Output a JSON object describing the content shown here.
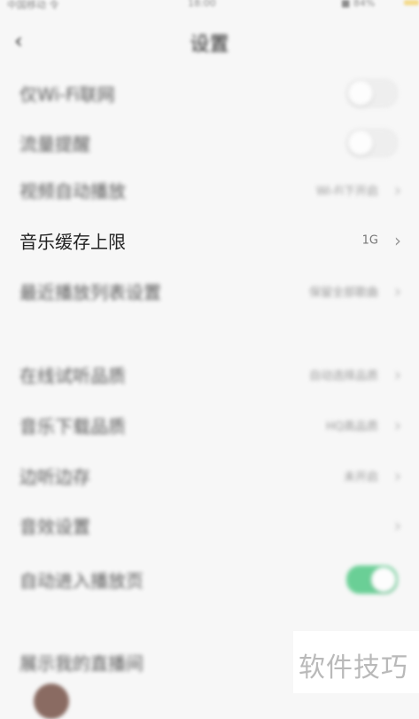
{
  "status_bar": {
    "carrier": "中国移动 令",
    "time": "18:00",
    "battery": "■ 84%",
    "battery_color": "#f1c232"
  },
  "nav": {
    "back_icon": "chevron-left-icon",
    "title": "设置"
  },
  "settings": [
    {
      "label": "仅Wi-Fi联网",
      "control": "toggle",
      "on": false
    },
    {
      "label": "流量提醒",
      "control": "toggle",
      "on": false
    },
    {
      "label": "视频自动播放",
      "value": "Wi-Fi下开启",
      "control": "chevron"
    },
    {
      "label": "音乐缓存上限",
      "value": "1G",
      "control": "chevron"
    },
    {
      "label": "最近播放列表设置",
      "value": "保留全部歌曲",
      "control": "chevron"
    },
    {
      "label": "在线试听品质",
      "value": "自动选择品质",
      "control": "chevron"
    },
    {
      "label": "音乐下载品质",
      "value": "HQ高品质",
      "control": "chevron"
    },
    {
      "label": "边听边存",
      "value": "未开启",
      "control": "chevron"
    },
    {
      "label": "音效设置",
      "value": "",
      "control": "chevron"
    },
    {
      "label": "自动进入播放页",
      "control": "toggle",
      "on": true
    },
    {
      "label": "展示我的直播间",
      "control": "none"
    }
  ],
  "colors": {
    "toggle_on": "#3cc276",
    "background": "#f7f7f7"
  },
  "watermark": "软件技巧"
}
